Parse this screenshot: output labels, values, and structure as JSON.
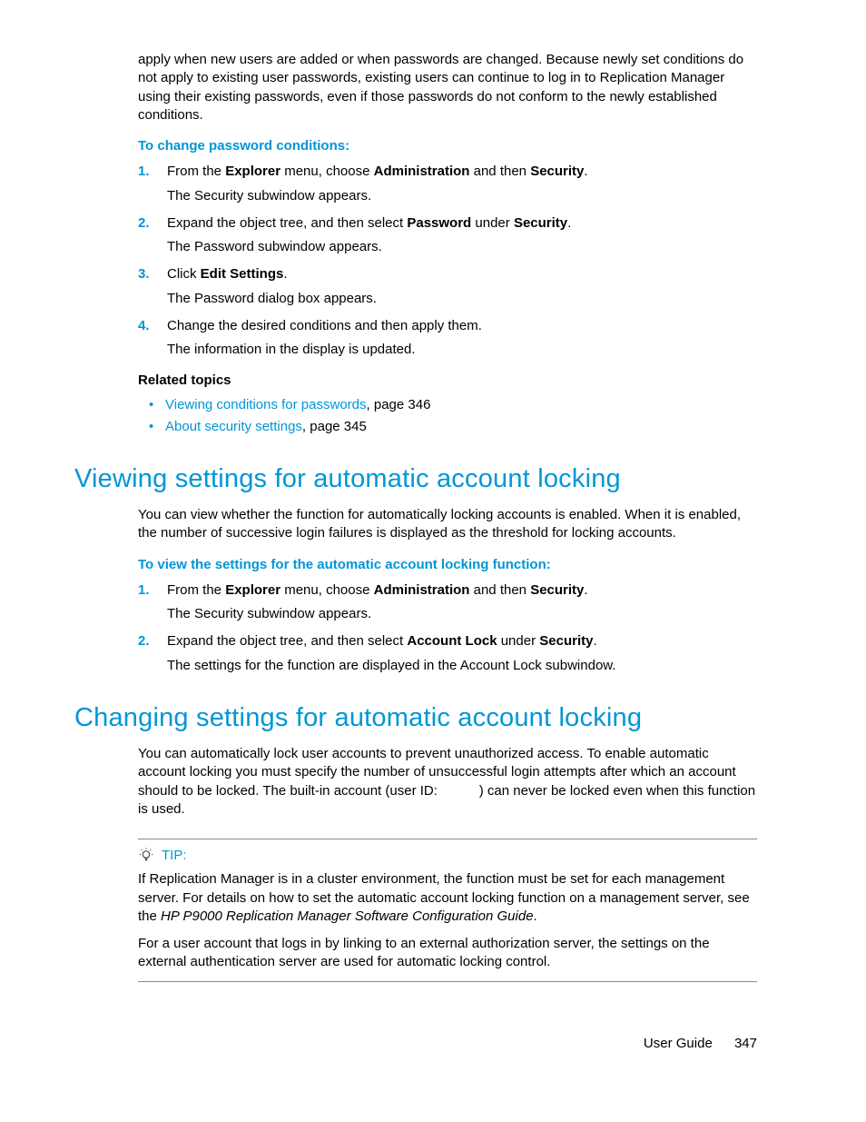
{
  "intro": "apply when new users are added or when passwords are changed. Because newly set conditions do not apply to existing user passwords, existing users can continue to log in to Replication Manager using their existing passwords, even if those passwords do not conform to the newly established conditions.",
  "proc1": {
    "heading": "To change password conditions:",
    "steps": [
      {
        "pre": "From the ",
        "b1": "Explorer",
        "mid1": " menu, choose ",
        "b2": "Administration",
        "mid2": " and then ",
        "b3": "Security",
        "post": ".",
        "sub": "The Security subwindow appears."
      },
      {
        "pre": "Expand the object tree, and then select ",
        "b1": "Password",
        "mid1": " under ",
        "b2": "Security",
        "post": ".",
        "sub": "The Password subwindow appears."
      },
      {
        "pre": "Click ",
        "b1": "Edit Settings",
        "post": ".",
        "sub": "The Password dialog box appears."
      },
      {
        "plain": "Change the desired conditions and then apply them.",
        "sub": "The information in the display is updated."
      }
    ]
  },
  "related": {
    "heading": "Related topics",
    "items": [
      {
        "link": "Viewing conditions for passwords",
        "tail": ", page 346"
      },
      {
        "link": "About security settings",
        "tail": ", page 345"
      }
    ]
  },
  "h_view": "Viewing settings for automatic account locking",
  "view_intro": "You can view whether the function for automatically locking accounts is enabled. When it is enabled, the number of successive login failures is displayed as the threshold for locking accounts.",
  "proc2": {
    "heading": "To view the settings for the automatic account locking function:",
    "steps": [
      {
        "pre": "From the ",
        "b1": "Explorer",
        "mid1": " menu, choose ",
        "b2": "Administration",
        "mid2": " and then ",
        "b3": "Security",
        "post": ".",
        "sub": "The Security subwindow appears."
      },
      {
        "pre": "Expand the object tree, and then select ",
        "b1": "Account Lock",
        "mid1": " under ",
        "b2": "Security",
        "post": ".",
        "sub": "The settings for the function are displayed in the Account Lock subwindow."
      }
    ]
  },
  "h_change": "Changing settings for automatic account locking",
  "change_intro_a": "You can automatically lock user accounts to prevent unauthorized access. To enable automatic account locking you must specify the number of unsuccessful login attempts after which an account should to be locked. The built-in account (user ID: ",
  "change_intro_b": ") can never be locked even when this function is used.",
  "tip": {
    "label": "TIP:",
    "p1a": "If Replication Manager is in a cluster environment, the function must be set for each management server. For details on how to set the automatic account locking function on a management server, see the ",
    "p1i": "HP P9000 Replication Manager Software Configuration Guide",
    "p1b": ".",
    "p2": "For a user account that logs in by linking to an external authorization server, the settings on the external authentication server are used for automatic locking control."
  },
  "footer": {
    "label": "User Guide",
    "page": "347"
  }
}
